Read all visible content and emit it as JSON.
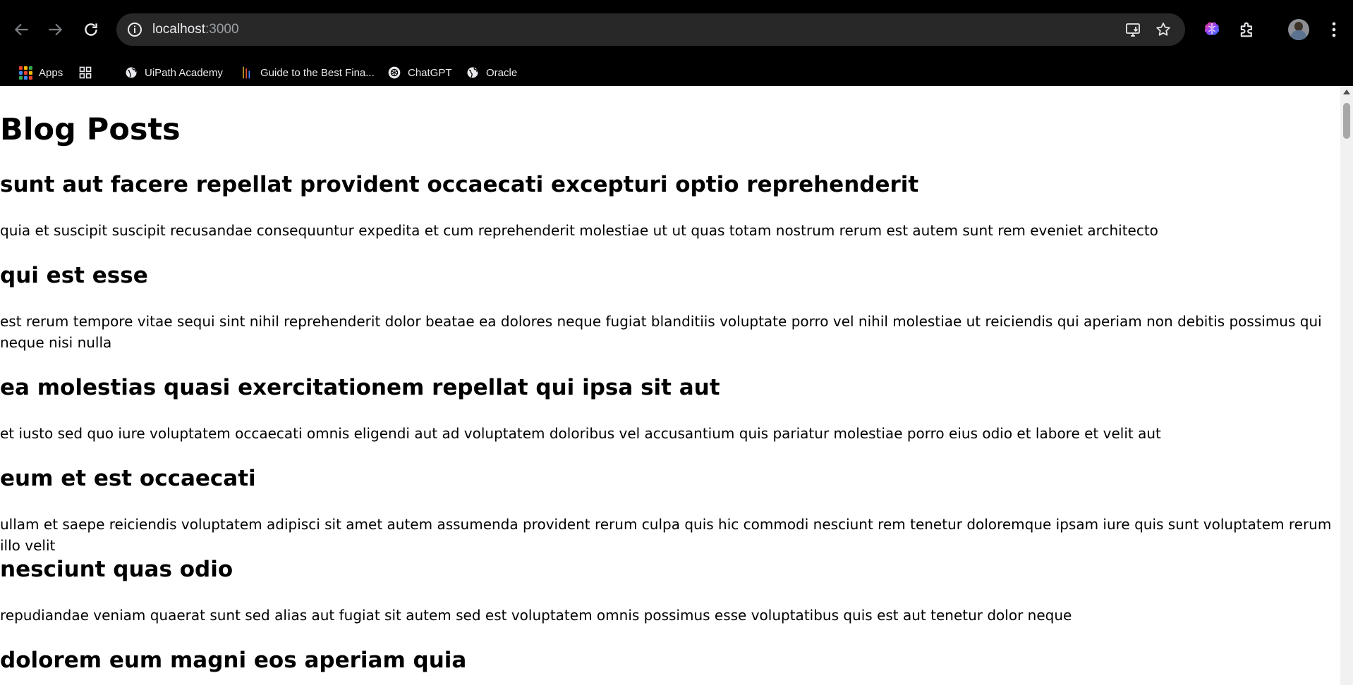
{
  "browser": {
    "url_host": "localhost",
    "url_port": ":3000",
    "icons": {
      "back": "arrow-left-icon",
      "forward": "arrow-right-icon",
      "reload": "reload-icon",
      "site_info": "info-circle-icon",
      "install": "install-app-icon",
      "bookmark": "star-icon",
      "extension_brain": "brain-extension-icon",
      "extensions": "puzzle-icon",
      "menu": "kebab-menu-icon"
    }
  },
  "bookmarks": {
    "apps_label": "Apps",
    "items": [
      {
        "label": "UiPath Academy",
        "icon": "globe-icon"
      },
      {
        "label": "Guide to the Best Fina...",
        "icon": "bars-icon"
      },
      {
        "label": "ChatGPT",
        "icon": "openai-icon"
      },
      {
        "label": "Oracle",
        "icon": "globe-icon"
      }
    ]
  },
  "page": {
    "title": "Blog Posts",
    "posts": [
      {
        "title": "sunt aut facere repellat provident occaecati excepturi optio reprehenderit",
        "body": "quia et suscipit suscipit recusandae consequuntur expedita et cum reprehenderit molestiae ut ut quas totam nostrum rerum est autem sunt rem eveniet architecto"
      },
      {
        "title": "qui est esse",
        "body": "est rerum tempore vitae sequi sint nihil reprehenderit dolor beatae ea dolores neque fugiat blanditiis voluptate porro vel nihil molestiae ut reiciendis qui aperiam non debitis possimus qui neque nisi nulla"
      },
      {
        "title": "ea molestias quasi exercitationem repellat qui ipsa sit aut",
        "body": "et iusto sed quo iure voluptatem occaecati omnis eligendi aut ad voluptatem doloribus vel accusantium quis pariatur molestiae porro eius odio et labore et velit aut"
      },
      {
        "title": "eum et est occaecati",
        "body": "ullam et saepe reiciendis voluptatem adipisci sit amet autem assumenda provident rerum culpa quis hic commodi nesciunt rem tenetur doloremque ipsam iure quis sunt voluptatem rerum illo velit"
      },
      {
        "title": "nesciunt quas odio",
        "body": "repudiandae veniam quaerat sunt sed alias aut fugiat sit autem sed est voluptatem omnis possimus esse voluptatibus quis est aut tenetur dolor neque"
      },
      {
        "title": "dolorem eum magni eos aperiam quia",
        "body": ""
      }
    ]
  },
  "colors": {
    "chrome_bg": "#000000",
    "omnibox_bg": "#282828",
    "page_bg": "#ffffff",
    "text": "#000000"
  }
}
